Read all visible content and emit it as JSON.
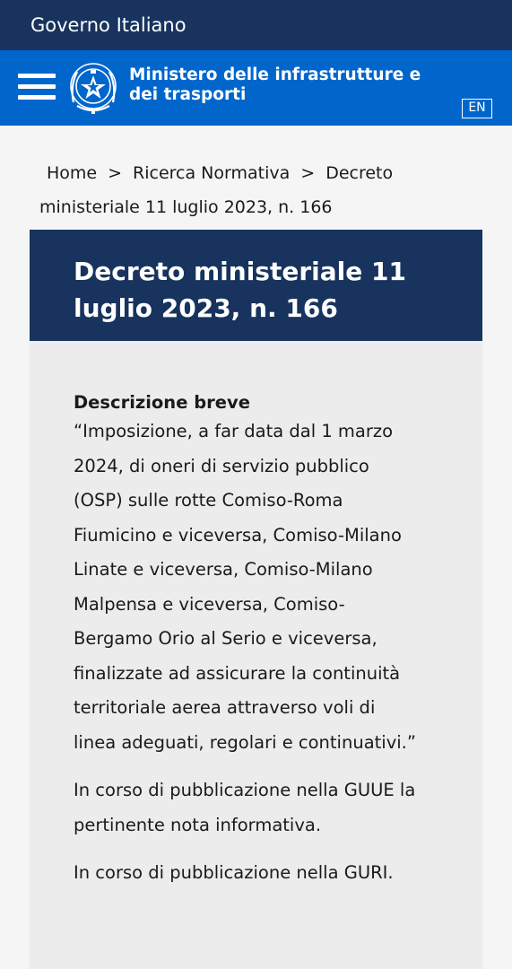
{
  "topbar": {
    "label": "Governo Italiano"
  },
  "header": {
    "menu_icon": "hamburger-menu-icon",
    "emblem_icon": "italian-republic-emblem-icon",
    "ministry_line1": "Ministero delle infrastrutture e",
    "ministry_line2": "dei trasporti",
    "language_button": "EN"
  },
  "breadcrumb": {
    "home": "Home",
    "separator": ">",
    "section": "Ricerca Normativa",
    "current_part1": "Decreto",
    "current_part2": "ministeriale 11 luglio 2023, n. 166"
  },
  "page": {
    "title_line1": "Decreto ministeriale 11",
    "title_line2": "luglio 2023, n. 166"
  },
  "content": {
    "description_label": "Descrizione breve",
    "description_lines": [
      "“Imposizione, a far data dal 1 marzo",
      "2024, di oneri di servizio pubblico",
      "(OSP) sulle rotte Comiso-Roma",
      "Fiumicino e viceversa, Comiso-Milano",
      "Linate e viceversa, Comiso-Milano",
      "Malpensa e viceversa, Comiso-",
      "Bergamo Orio al Serio e viceversa,",
      "finalizzate ad assicurare la continuità",
      "territoriale aerea attraverso voli di",
      "linea adeguati, regolari e continuativi.”"
    ],
    "guue_line1": "In corso di pubblicazione nella GUUE la",
    "guue_line2": "pertinente nota informativa.",
    "guri": "In corso di pubblicazione nella GURI."
  },
  "colors": {
    "topbar_bg": "#17335e",
    "header_bg": "#0066cc",
    "title_bg": "#17335e",
    "content_bg": "#ececec",
    "page_bg": "#f5f5f5"
  }
}
